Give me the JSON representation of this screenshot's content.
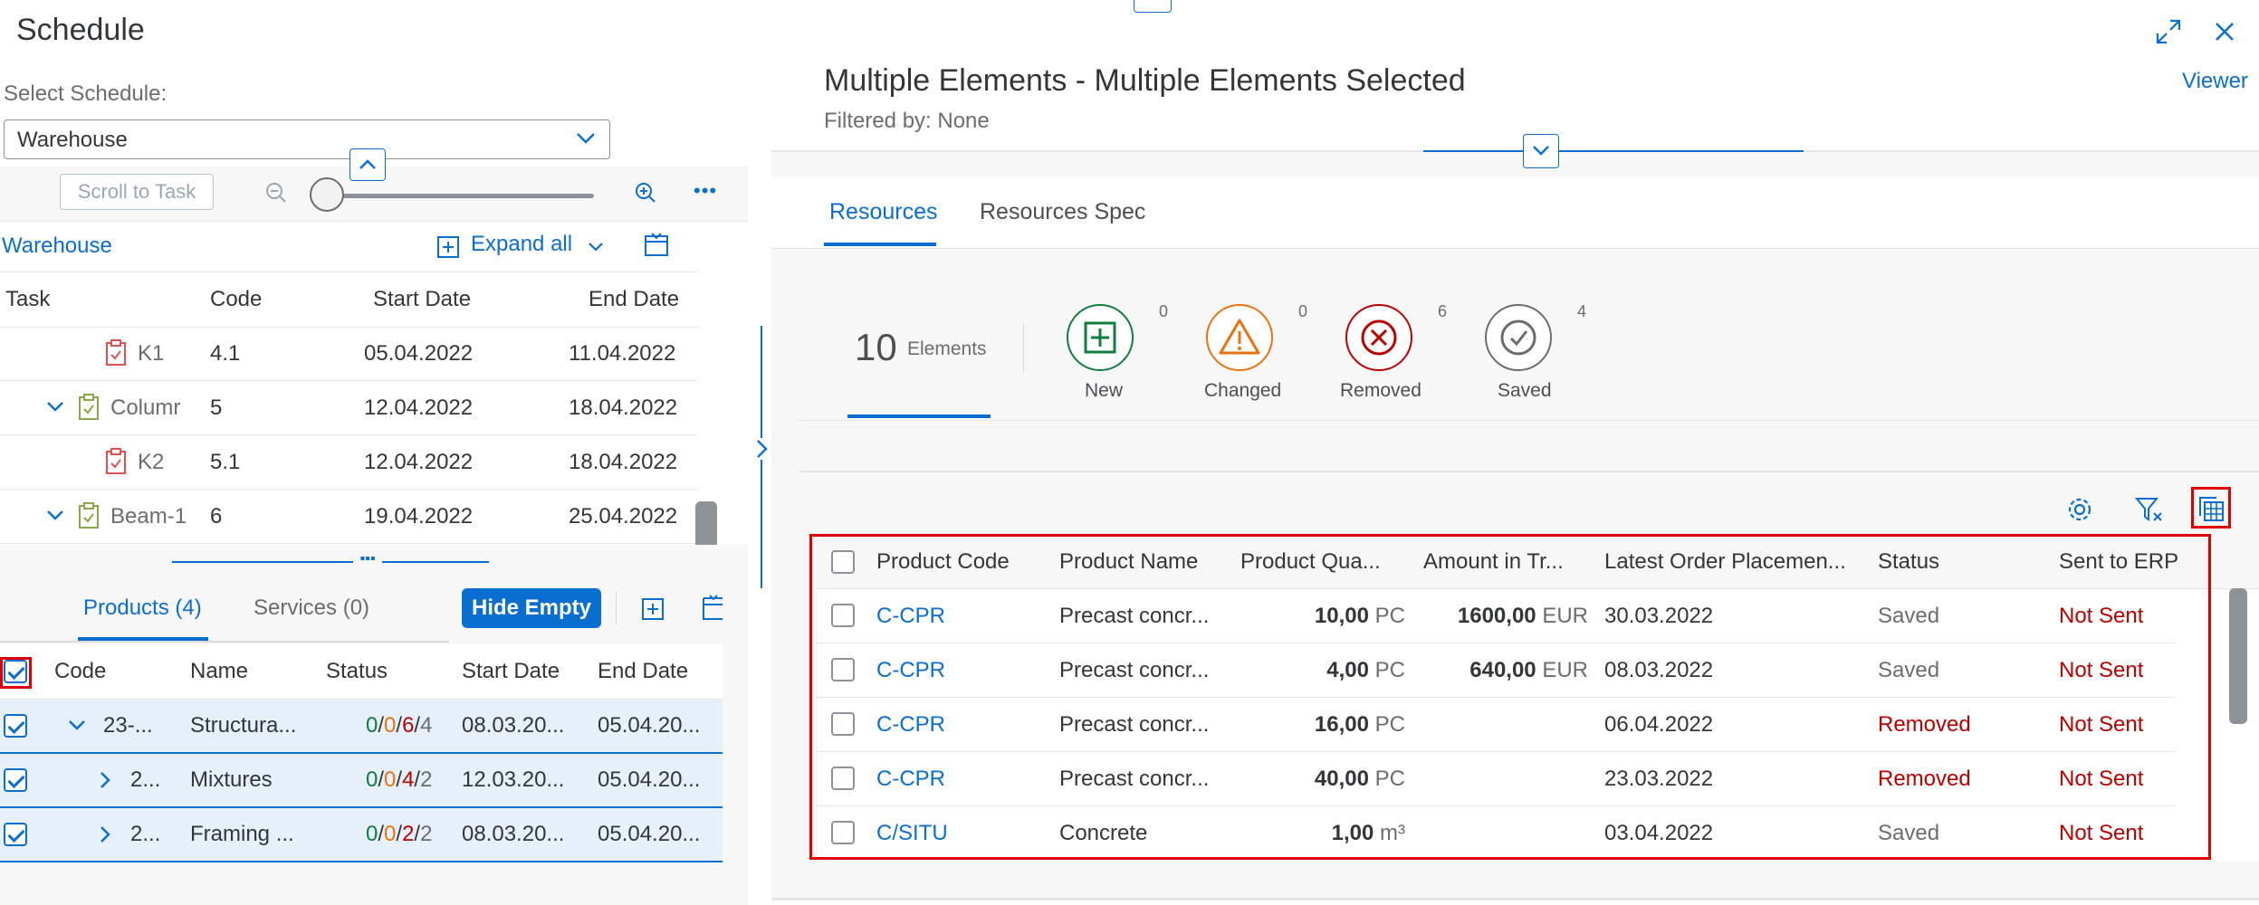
{
  "left": {
    "title": "Schedule",
    "select_label": "Select Schedule:",
    "select_value": "Warehouse",
    "toolbar": {
      "scroll_to_task": "Scroll to Task",
      "more": "•••"
    },
    "tree_header": {
      "root": "Warehouse",
      "expand_all": "Expand all"
    },
    "columns": [
      "Task",
      "Code",
      "Start Date",
      "End Date"
    ],
    "rows": [
      {
        "task": "K1",
        "code": "4.1",
        "start": "05.04.2022",
        "end": "11.04.2022",
        "level": 2,
        "expandable": false
      },
      {
        "task": "Columr",
        "code": "5",
        "start": "12.04.2022",
        "end": "18.04.2022",
        "level": 1,
        "expandable": true
      },
      {
        "task": "K2",
        "code": "5.1",
        "start": "12.04.2022",
        "end": "18.04.2022",
        "level": 2,
        "expandable": false
      },
      {
        "task": "Beam-1",
        "code": "6",
        "start": "19.04.2022",
        "end": "25.04.2022",
        "level": 1,
        "expandable": true
      }
    ],
    "tabs": [
      {
        "label": "Products (4)",
        "active": true
      },
      {
        "label": "Services (0)",
        "active": false
      }
    ],
    "hide_empty": "Hide Empty",
    "product_columns": [
      "Code",
      "Name",
      "Status",
      "Start Date",
      "End Date"
    ],
    "products": [
      {
        "code": "23-...",
        "name": "Structura...",
        "s1": "0",
        "s2": "0",
        "s3": "6",
        "s4": "4",
        "start": "08.03.20...",
        "end": "05.04.20...",
        "expand": "down",
        "checked": true
      },
      {
        "code": "2...",
        "name": "Mixtures",
        "s1": "0",
        "s2": "0",
        "s3": "4",
        "s4": "2",
        "start": "12.03.20...",
        "end": "05.04.20...",
        "expand": "right",
        "checked": true
      },
      {
        "code": "2...",
        "name": "Framing ...",
        "s1": "0",
        "s2": "0",
        "s3": "2",
        "s4": "2",
        "start": "08.03.20...",
        "end": "05.04.20...",
        "expand": "right",
        "checked": true
      }
    ]
  },
  "right": {
    "title": "Multiple Elements - Multiple Elements Selected",
    "subtitle": "Filtered by: None",
    "viewer": "Viewer",
    "tabs": [
      {
        "label": "Resources",
        "active": true
      },
      {
        "label": "Resources Spec",
        "active": false
      }
    ],
    "summary": {
      "count": "10",
      "label": "Elements"
    },
    "statuses": [
      {
        "label": "New",
        "count": "0",
        "color": "#107e3e",
        "icon": "plus-square-icon"
      },
      {
        "label": "Changed",
        "count": "0",
        "color": "#e9730c",
        "icon": "warning-icon"
      },
      {
        "label": "Removed",
        "count": "6",
        "color": "#bb0000",
        "icon": "cross-circle-icon"
      },
      {
        "label": "Saved",
        "count": "4",
        "color": "#6a6d70",
        "icon": "check-circle-icon"
      }
    ],
    "columns": [
      "Product Code",
      "Product Name",
      "Product Qua...",
      "Amount in Tr...",
      "Latest Order Placemen...",
      "Status",
      "Sent to ERP"
    ],
    "rows": [
      {
        "code": "C-CPR",
        "name": "Precast concr...",
        "qty": "10,00",
        "qty_unit": "PC",
        "amount": "1600,00",
        "amount_unit": "EUR",
        "date": "30.03.2022",
        "status": "Saved",
        "status_color": "#6a6d70",
        "erp": "Not Sent"
      },
      {
        "code": "C-CPR",
        "name": "Precast concr...",
        "qty": "4,00",
        "qty_unit": "PC",
        "amount": "640,00",
        "amount_unit": "EUR",
        "date": "08.03.2022",
        "status": "Saved",
        "status_color": "#6a6d70",
        "erp": "Not Sent"
      },
      {
        "code": "C-CPR",
        "name": "Precast concr...",
        "qty": "16,00",
        "qty_unit": "PC",
        "amount": "",
        "amount_unit": "",
        "date": "06.04.2022",
        "status": "Removed",
        "status_color": "#bb0000",
        "erp": "Not Sent"
      },
      {
        "code": "C-CPR",
        "name": "Precast concr...",
        "qty": "40,00",
        "qty_unit": "PC",
        "amount": "",
        "amount_unit": "",
        "date": "23.03.2022",
        "status": "Removed",
        "status_color": "#bb0000",
        "erp": "Not Sent"
      },
      {
        "code": "C/SITU",
        "name": "Concrete",
        "qty": "1,00",
        "qty_unit": "m³",
        "amount": "",
        "amount_unit": "",
        "date": "03.04.2022",
        "status": "Saved",
        "status_color": "#6a6d70",
        "erp": "Not Sent"
      }
    ]
  }
}
